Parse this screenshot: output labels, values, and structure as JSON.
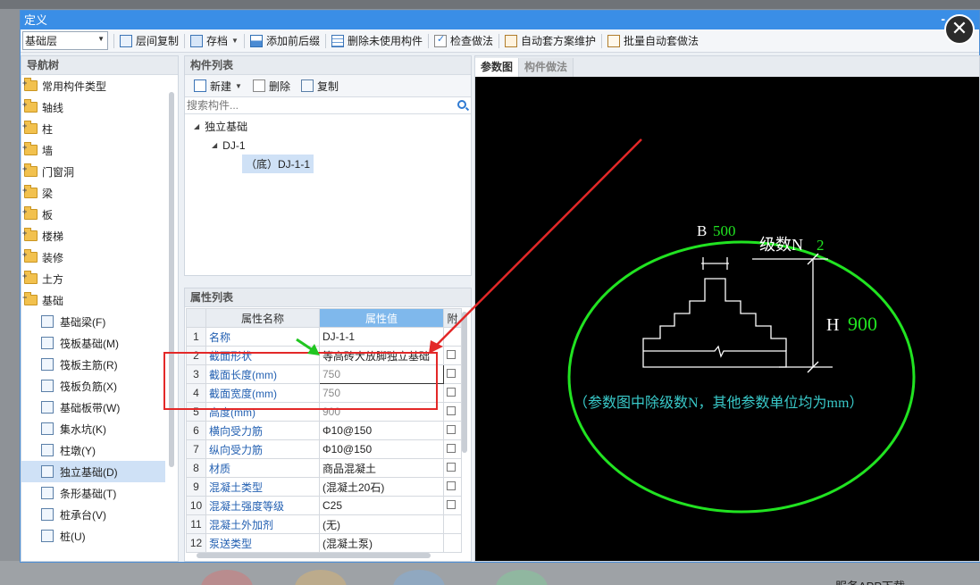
{
  "dialog": {
    "title": "定义",
    "minimize_label": "-",
    "close_label": "✕"
  },
  "toolbar": {
    "floor": "基础层",
    "items": [
      "层间复制",
      "存档",
      "添加前后缀",
      "删除未使用构件",
      "检查做法",
      "自动套方案维护",
      "批量自动套做法"
    ]
  },
  "nav": {
    "header": "导航树",
    "folders": [
      "常用构件类型",
      "轴线",
      "柱",
      "墙",
      "门窗洞",
      "梁",
      "板",
      "楼梯",
      "装修",
      "土方",
      "基础"
    ],
    "children": [
      "基础梁(F)",
      "筏板基础(M)",
      "筏板主筋(R)",
      "筏板负筋(X)",
      "基础板带(W)",
      "集水坑(K)",
      "柱墩(Y)",
      "独立基础(D)",
      "条形基础(T)",
      "桩承台(V)",
      "桩(U)"
    ]
  },
  "components": {
    "header": "构件列表",
    "new_label": "新建",
    "delete_label": "删除",
    "copy_label": "复制",
    "search_placeholder": "搜索构件...",
    "tree_root": "独立基础",
    "tree_child": "DJ-1",
    "tree_leaf": "（底）DJ-1-1"
  },
  "properties": {
    "header": "属性列表",
    "col_name": "属性名称",
    "col_value": "属性值",
    "col_attach": "附",
    "rows": [
      {
        "num": "1",
        "name": "名称",
        "value": "DJ-1-1"
      },
      {
        "num": "2",
        "name": "截面形状",
        "value": "等高砖大放脚独立基础"
      },
      {
        "num": "3",
        "name": "截面长度(mm)",
        "value": "750"
      },
      {
        "num": "4",
        "name": "截面宽度(mm)",
        "value": "750"
      },
      {
        "num": "5",
        "name": "高度(mm)",
        "value": "900"
      },
      {
        "num": "6",
        "name": "横向受力筋",
        "value": "Φ10@150"
      },
      {
        "num": "7",
        "name": "纵向受力筋",
        "value": "Φ10@150"
      },
      {
        "num": "8",
        "name": "材质",
        "value": "商品混凝土"
      },
      {
        "num": "9",
        "name": "混凝土类型",
        "value": "(混凝土20石)"
      },
      {
        "num": "10",
        "name": "混凝土强度等级",
        "value": "C25"
      },
      {
        "num": "11",
        "name": "混凝土外加剂",
        "value": "(无)"
      },
      {
        "num": "12",
        "name": "泵送类型",
        "value": "(混凝土泵)"
      }
    ]
  },
  "diagram": {
    "tab_active": "参数图",
    "tab_inactive": "构件做法",
    "label_b": "B",
    "value_b": "500",
    "label_n": "级数N",
    "value_n": "2",
    "label_h": "H",
    "value_h": "900",
    "note": "（参数图中除级数N，其他参数单位均为mm）"
  },
  "background": {
    "bottom_text": "服务APP下载"
  },
  "colors": {
    "accent": "#3a8ee6",
    "annotation_red": "#e32828",
    "diagram_green": "#21e321",
    "diagram_cyan": "#39c9c9"
  }
}
